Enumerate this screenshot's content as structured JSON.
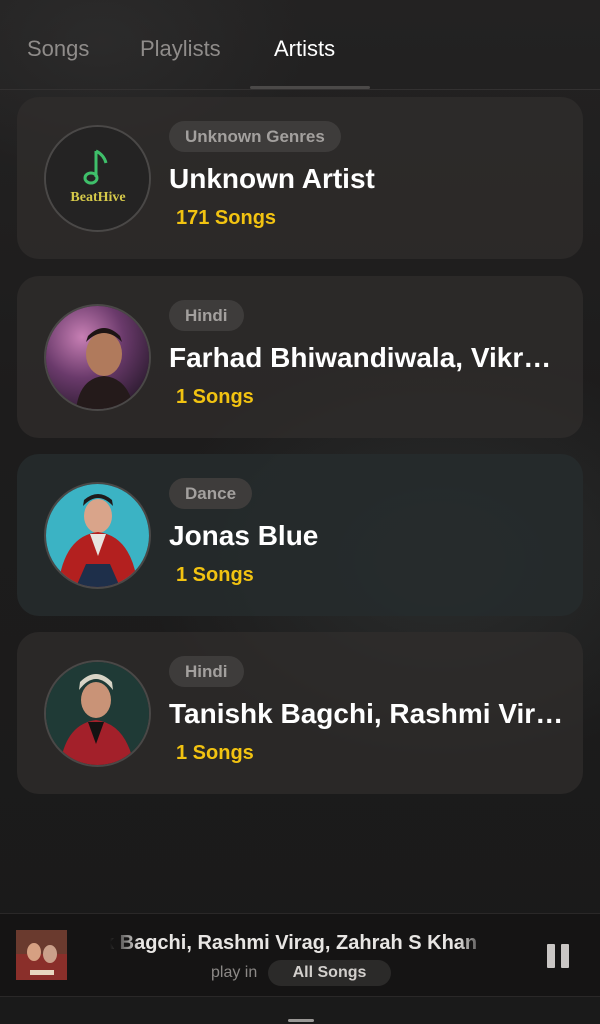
{
  "tabs": [
    {
      "label": "Songs",
      "active": false
    },
    {
      "label": "Playlists",
      "active": false
    },
    {
      "label": "Artists",
      "active": true
    }
  ],
  "artists": [
    {
      "genre": "Unknown Genres",
      "name": "Unknown Artist",
      "songs": "171 Songs",
      "avatar": "beathive-logo"
    },
    {
      "genre": "Hindi",
      "name": "Farhad Bhiwandiwala, Vikram Montrose",
      "songs": "1 Songs",
      "avatar": "artist-photo"
    },
    {
      "genre": "Dance",
      "name": "Jonas Blue",
      "songs": "1 Songs",
      "avatar": "artist-photo"
    },
    {
      "genre": "Hindi",
      "name": "Tanishk Bagchi, Rashmi Virag, Zahrah S Khan",
      "songs": "1 Songs",
      "avatar": "artist-photo"
    }
  ],
  "logo_text": "BeatHive",
  "player": {
    "title": "Tanishk Bagchi, Rashmi Virag, Zahrah S Khan",
    "play_in_label": "play in",
    "context": "All Songs",
    "state": "playing",
    "control_icon": "pause-icon"
  },
  "colors": {
    "accent": "#f2c311",
    "background": "#1c1b1b",
    "card": "#302e2d",
    "logo_green": "#3fbf6a"
  }
}
